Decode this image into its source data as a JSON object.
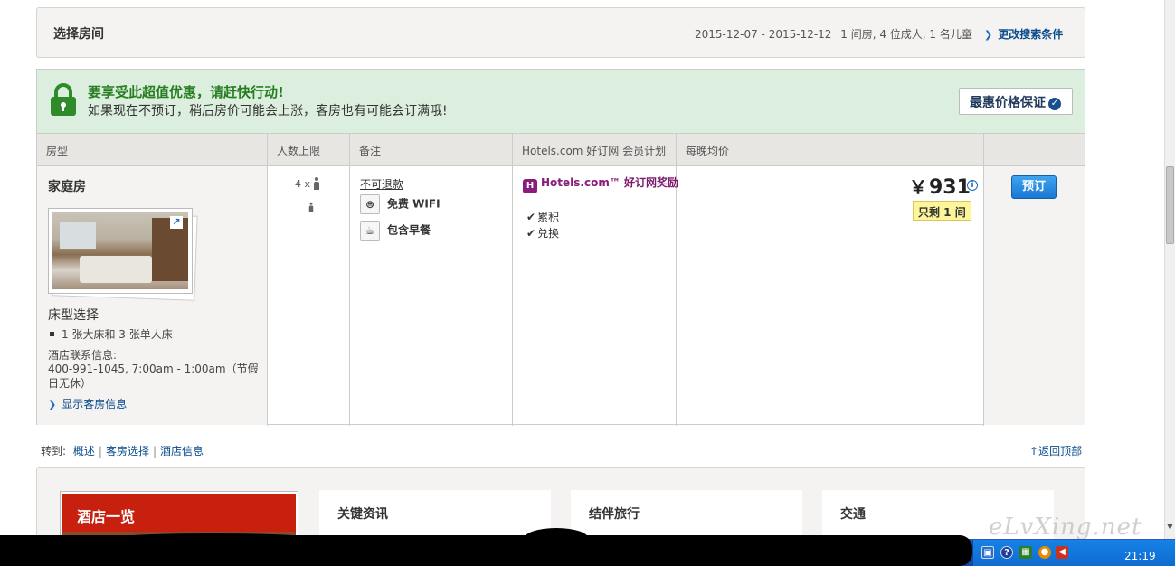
{
  "search": {
    "title": "选择房间",
    "dates": "2015-12-07 - 2015-12-12",
    "occupancy": "1 间房, 4 位成人, 1 名儿童",
    "modify_label": "更改搜索条件"
  },
  "banner": {
    "headline": "要享受此超值优惠，请赶快行动!",
    "subtext": "如果现在不预订，稍后房价可能会上涨，客房也有可能会订满哦!",
    "guarantee_label": "最惠价格保证"
  },
  "table": {
    "headers": [
      "房型",
      "人数上限",
      "备注",
      "Hotels.com 好订网 会员计划",
      "每晚均价"
    ]
  },
  "room": {
    "name": "家庭房",
    "bed_title": "床型选择",
    "bed_option": "1 张大床和 3 张单人床",
    "contact_title": "酒店联系信息:",
    "contact_detail": "400-991-1045, 7:00am - 1:00am（节假日无休）",
    "show_info_label": "显示客房信息",
    "max_occupancy": "4 x",
    "policy": "不可退款",
    "features": [
      {
        "icon": "wifi-icon",
        "label": "免费 WIFI"
      },
      {
        "icon": "coffee-cup-icon",
        "label": "包含早餐"
      }
    ],
    "rewards": {
      "brand": "Hotels.com™",
      "program": "好订网奖励",
      "items": [
        "累积",
        "兑换"
      ]
    },
    "price": {
      "currency": "￥",
      "amount": "931",
      "availability": "只剩 1 间"
    },
    "book_label": "预订"
  },
  "jump": {
    "label": "转到:",
    "links": [
      "概述",
      "客房选择",
      "酒店信息"
    ],
    "back_to_top": "返回顶部"
  },
  "lower": {
    "overview": "酒店一览",
    "cards": [
      "关键资讯",
      "结伴旅行",
      "交通"
    ]
  },
  "taskbar": {
    "clock": "21:19"
  },
  "watermark": "eLvXing.net",
  "colors": {
    "banner_bg": "#dceedd",
    "headline_green": "#267d22",
    "link_blue": "#0a4b8c",
    "book_button": "#1a78d4",
    "availability_yellow": "#fdf59a",
    "overview_red": "#c8200f"
  }
}
